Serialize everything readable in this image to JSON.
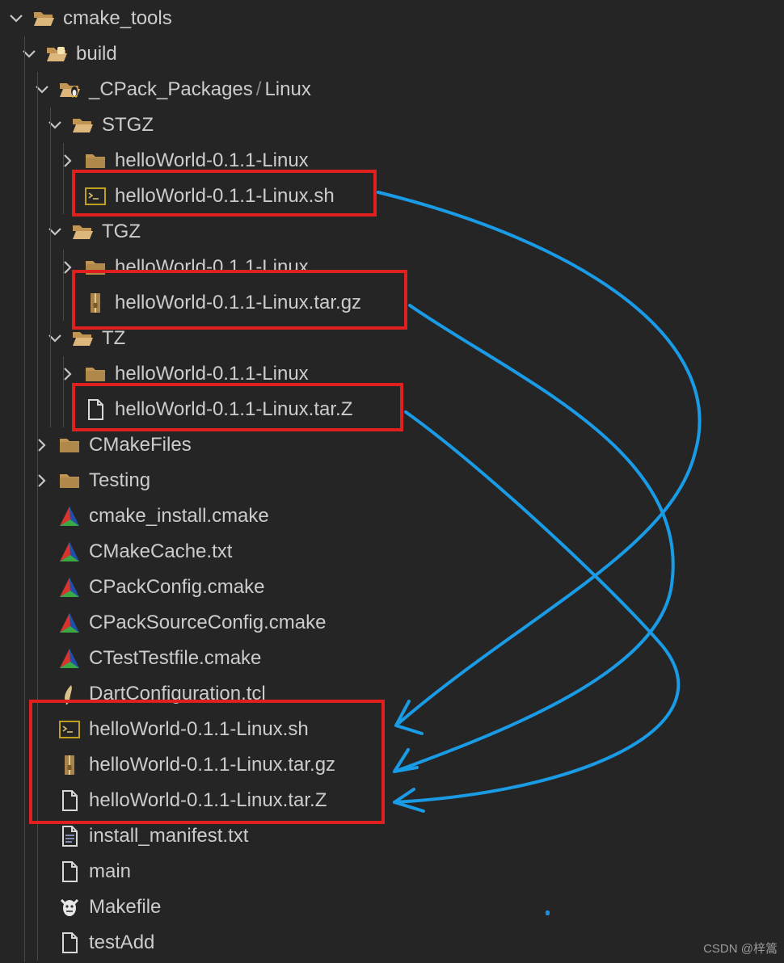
{
  "explorer": {
    "items": [
      {
        "label": "cmake_tools",
        "kind": "folder-open",
        "depth": 0,
        "chevron": "down"
      },
      {
        "label": "build",
        "kind": "folder-build",
        "depth": 1,
        "chevron": "down"
      },
      {
        "label": "_CPack_Packages",
        "sublabel": "Linux",
        "kind": "folder-linux",
        "depth": 2,
        "chevron": "down"
      },
      {
        "label": "STGZ",
        "kind": "folder-open",
        "depth": 3,
        "chevron": "down"
      },
      {
        "label": "helloWorld-0.1.1-Linux",
        "kind": "folder",
        "depth": 4,
        "chevron": "right"
      },
      {
        "label": "helloWorld-0.1.1-Linux.sh",
        "kind": "shell",
        "depth": 4,
        "chevron": ""
      },
      {
        "label": "TGZ",
        "kind": "folder-open",
        "depth": 3,
        "chevron": "down"
      },
      {
        "label": "helloWorld-0.1.1-Linux",
        "kind": "folder",
        "depth": 4,
        "chevron": "right"
      },
      {
        "label": "helloWorld-0.1.1-Linux.tar.gz",
        "kind": "archive",
        "depth": 4,
        "chevron": ""
      },
      {
        "label": "TZ",
        "kind": "folder-open",
        "depth": 3,
        "chevron": "down"
      },
      {
        "label": "helloWorld-0.1.1-Linux",
        "kind": "folder",
        "depth": 4,
        "chevron": "right"
      },
      {
        "label": "helloWorld-0.1.1-Linux.tar.Z",
        "kind": "file",
        "depth": 4,
        "chevron": ""
      },
      {
        "label": "CMakeFiles",
        "kind": "folder",
        "depth": 2,
        "chevron": "right"
      },
      {
        "label": "Testing",
        "kind": "folder",
        "depth": 2,
        "chevron": "right"
      },
      {
        "label": "cmake_install.cmake",
        "kind": "cmake",
        "depth": 2,
        "chevron": ""
      },
      {
        "label": "CMakeCache.txt",
        "kind": "cmake",
        "depth": 2,
        "chevron": ""
      },
      {
        "label": "CPackConfig.cmake",
        "kind": "cmake",
        "depth": 2,
        "chevron": ""
      },
      {
        "label": "CPackSourceConfig.cmake",
        "kind": "cmake",
        "depth": 2,
        "chevron": ""
      },
      {
        "label": "CTestTestfile.cmake",
        "kind": "cmake",
        "depth": 2,
        "chevron": ""
      },
      {
        "label": "DartConfiguration.tcl",
        "kind": "tcl",
        "depth": 2,
        "chevron": ""
      },
      {
        "label": "helloWorld-0.1.1-Linux.sh",
        "kind": "shell",
        "depth": 2,
        "chevron": ""
      },
      {
        "label": "helloWorld-0.1.1-Linux.tar.gz",
        "kind": "archive",
        "depth": 2,
        "chevron": ""
      },
      {
        "label": "helloWorld-0.1.1-Linux.tar.Z",
        "kind": "file",
        "depth": 2,
        "chevron": ""
      },
      {
        "label": "install_manifest.txt",
        "kind": "text",
        "depth": 2,
        "chevron": ""
      },
      {
        "label": "main",
        "kind": "file",
        "depth": 2,
        "chevron": ""
      },
      {
        "label": "Makefile",
        "kind": "gnu",
        "depth": 2,
        "chevron": ""
      },
      {
        "label": "testAdd",
        "kind": "file",
        "depth": 2,
        "chevron": ""
      }
    ]
  },
  "watermark": "CSDN @梓篙",
  "colors": {
    "background": "#252526",
    "text": "#cccccc",
    "highlight": "#e0201f",
    "arrow": "#1a9be6",
    "folder": "#c09553"
  }
}
